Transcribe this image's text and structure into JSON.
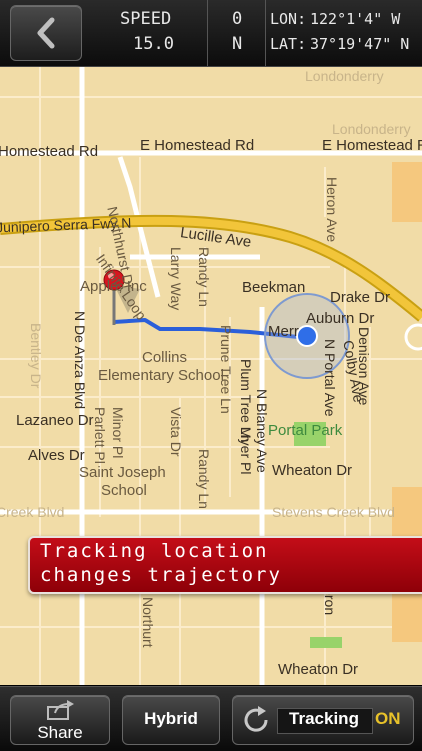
{
  "status": {
    "speed_label": "SPEED",
    "speed_value": "15.0",
    "heading_value": "0",
    "heading_dir": "N",
    "lon_label": "LON:",
    "lon_value": "122°1'4\" W",
    "lat_label": "LAT:",
    "lat_value": "37°19'47\" N"
  },
  "map": {
    "streets": {
      "homestead_west": "Homestead Rd",
      "homestead_mid": "E Homestead Rd",
      "homestead_east": "E Homestead Rd",
      "freeway": "Junipero Serra Fwy N",
      "northhurst": "Northhurst Dr",
      "lucille": "Lucille Ave",
      "infinite_loop": "Infinite Loop",
      "larry_way": "Larry Way",
      "randy_ln_top": "Randy Ln",
      "beekman": "Beekman",
      "drake": "Drake Dr",
      "heron_top": "Heron Ave",
      "apple": "Apple, Inc",
      "de_anza": "N De Anza Blvd",
      "collins": "Collins",
      "collins_school": "Elementary School",
      "prune_tree": "Prune Tree Ln",
      "plum_tree": "Plum Tree Ln",
      "myer": "Myer Pl",
      "blaney": "N Blaney Ave",
      "auburn": "Auburn Dr",
      "denison": "Denison Ave",
      "colby": "Colby Ave",
      "portal": "N Portal Ave",
      "merr": "Merr",
      "lazaneo": "Lazaneo Dr",
      "minor": "Minor Pl",
      "parlett": "Parlett Pl",
      "vista": "Vista Dr",
      "randy_ln_bottom": "Randy Ln",
      "alves": "Alves Dr",
      "st_joseph": "Saint Joseph",
      "st_joseph_school": "School",
      "portal_park": "Portal Park",
      "wheaton": "Wheaton Dr",
      "wheaton_bottom": "Wheaton Dr",
      "stevens_creek": "Stevens Creek Blvd",
      "creek_blvd": "Creek Blvd",
      "londonderry": "Londonderry",
      "bentley": "Bentley Dr",
      "heron_bottom": "Heron",
      "northurt": "Northurt"
    }
  },
  "banner": {
    "line1": "Tracking location",
    "line2": "changes trajectory"
  },
  "toolbar": {
    "share_label": "Share",
    "hybrid_label": "Hybrid",
    "tracking_label": "Tracking",
    "tracking_state": "ON"
  },
  "colors": {
    "banner_red": "#b30a14",
    "route_blue": "#2b5fd9",
    "on_yellow": "#e8c22a",
    "map_tan": "#f1dca7"
  }
}
